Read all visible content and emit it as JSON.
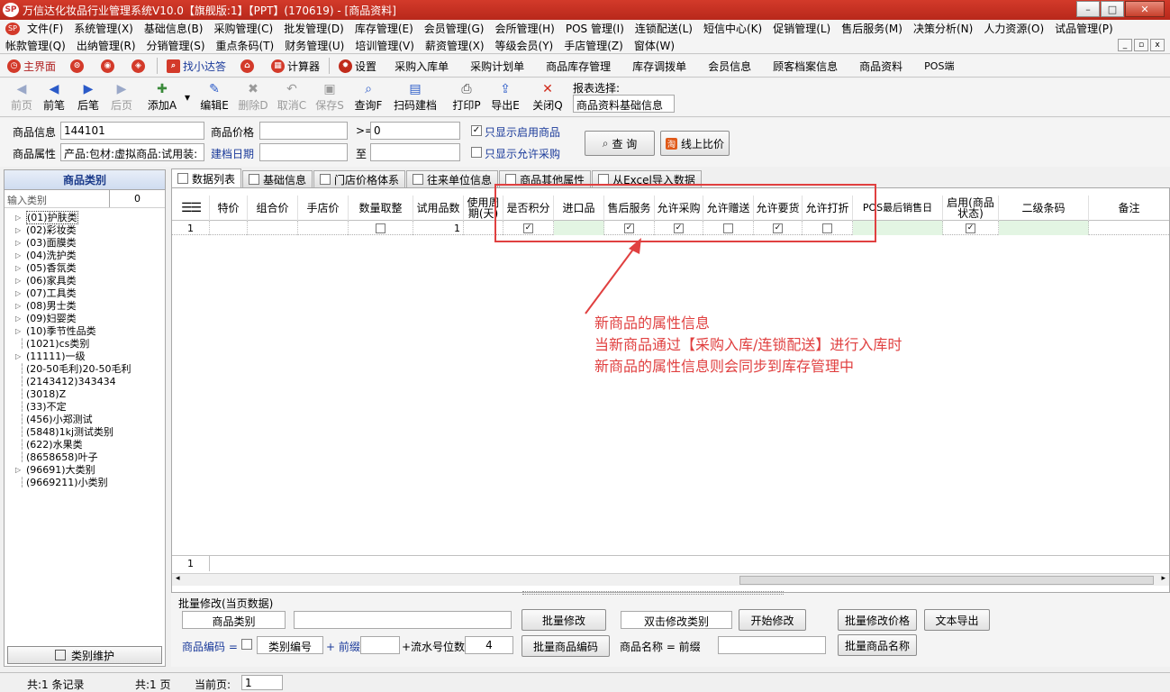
{
  "window": {
    "title": "万信达化妆品行业管理系统V10.0【旗舰版:1】【PPT】(170619) - [商品资料]",
    "logo": "SP",
    "buttons": [
      "–",
      "□",
      "✕"
    ]
  },
  "menu_row1": [
    "文件(F)",
    "系统管理(X)",
    "基础信息(B)",
    "采购管理(C)",
    "批发管理(D)",
    "库存管理(E)",
    "会员管理(G)",
    "会所管理(H)",
    "POS 管理(I)",
    "连锁配送(L)",
    "短信中心(K)",
    "促销管理(L)",
    "售后服务(M)",
    "决策分析(N)",
    "人力资源(O)",
    "试品管理(P)"
  ],
  "menu_row2": [
    "帐款管理(Q)",
    "出纳管理(R)",
    "分销管理(S)",
    "重点条码(T)",
    "财务管理(U)",
    "培训管理(V)",
    "薪资管理(X)",
    "等级会员(Y)",
    "手店管理(Z)",
    "窗体(W)"
  ],
  "mdi_buttons": [
    "_",
    "▫",
    "x"
  ],
  "quickbar": {
    "main": "主界面",
    "find": "找小达答",
    "calc": "计算器",
    "settings": "设置",
    "links": [
      "采购入库单",
      "采购计划单",
      "商品库存管理",
      "库存调拨单",
      "会员信息",
      "顾客档案信息",
      "商品资料",
      "POS端"
    ]
  },
  "actionbar": {
    "buttons": [
      {
        "label": "前页",
        "icon": "◀",
        "disabled": true
      },
      {
        "label": "前笔",
        "icon": "◀",
        "disabled": false
      },
      {
        "label": "后笔",
        "icon": "▶",
        "disabled": false
      },
      {
        "label": "后页",
        "icon": "▶",
        "disabled": true
      },
      {
        "label": "添加A",
        "icon": "✚",
        "disabled": false
      },
      {
        "label": "编辑E",
        "icon": "✎",
        "disabled": false
      },
      {
        "label": "删除D",
        "icon": "✖",
        "disabled": true
      },
      {
        "label": "取消C",
        "icon": "↶",
        "disabled": true
      },
      {
        "label": "保存S",
        "icon": "▣",
        "disabled": true
      },
      {
        "label": "查询F",
        "icon": "⌕",
        "disabled": false
      },
      {
        "label": "扫码建档",
        "icon": "▤",
        "disabled": false
      },
      {
        "label": "打印P",
        "icon": "⎙",
        "disabled": false
      },
      {
        "label": "导出E",
        "icon": "⇪",
        "disabled": false
      },
      {
        "label": "关闭Q",
        "icon": "✕",
        "disabled": false
      }
    ],
    "report_label": "报表选择:",
    "report_value": "商品资料基础信息"
  },
  "filter": {
    "product_info_label": "商品信息",
    "product_info_value": "144101",
    "price_label": "商品价格",
    "price_op": ">=",
    "price_value": "0",
    "only_enabled": "只显示启用商品",
    "attr_label": "商品属性",
    "attr_value": "产品:包材:虚拟商品:试用装:",
    "date_label": "建档日期",
    "date_to": "至",
    "only_purchase": "只显示允许采购",
    "query_btn": "查  询",
    "compare_btn": "线上比价"
  },
  "leftpanel": {
    "title": "商品类别",
    "search_placeholder": "输入类别",
    "search_count": "0",
    "categories": [
      {
        "label": "(01)护肤类",
        "expandable": true
      },
      {
        "label": "(02)彩妆类",
        "expandable": true
      },
      {
        "label": "(03)面膜类",
        "expandable": true
      },
      {
        "label": "(04)洗护类",
        "expandable": true
      },
      {
        "label": "(05)香氛类",
        "expandable": true
      },
      {
        "label": "(06)家具类",
        "expandable": true
      },
      {
        "label": "(07)工具类",
        "expandable": true
      },
      {
        "label": "(08)男士类",
        "expandable": true
      },
      {
        "label": "(09)妇婴类",
        "expandable": true
      },
      {
        "label": "(10)季节性品类",
        "expandable": true
      },
      {
        "label": "(1021)cs类别",
        "expandable": false
      },
      {
        "label": "(11111)一级",
        "expandable": true
      },
      {
        "label": "(20-50毛利)20-50毛利",
        "expandable": false
      },
      {
        "label": "(2143412)343434",
        "expandable": false
      },
      {
        "label": "(3018)Z",
        "expandable": false
      },
      {
        "label": "(33)不定",
        "expandable": false
      },
      {
        "label": "(456)小郑测试",
        "expandable": false
      },
      {
        "label": "(5848)1kj测试类别",
        "expandable": false
      },
      {
        "label": "(622)水果类",
        "expandable": false
      },
      {
        "label": "(8658658)叶子",
        "expandable": false
      },
      {
        "label": "(96691)大类别",
        "expandable": true
      },
      {
        "label": "(9669211)小类别",
        "expandable": false
      }
    ],
    "maintain_btn": "类别维护"
  },
  "tabs": [
    "数据列表",
    "基础信息",
    "门店价格体系",
    "往来单位信息",
    "商品其他属性",
    "从Excel导入数据"
  ],
  "grid": {
    "headers": [
      "特价",
      "组合价",
      "手店价",
      "数量取整",
      "试用品数",
      "使用周期(天)",
      "是否积分",
      "进口品",
      "售后服务",
      "允许采购",
      "允许赠送",
      "允许要货",
      "允许打折",
      "POS最后销售日",
      "启用(商品状态)",
      "二级条码",
      "备注"
    ],
    "row_number": "1",
    "trial_qty": "1",
    "footer_number": "1"
  },
  "annotation": [
    "新商品的属性信息",
    "当新商品通过【采购入库/连锁配送】进行入库时",
    "新商品的属性信息则会同步到库存管理中"
  ],
  "batch": {
    "title": "批量修改(当页数据)",
    "category_field": "商品类别",
    "batch_modify_btn": "批量修改",
    "dblclick_field": "双击修改类别",
    "start_btn": "开始修改",
    "batch_price_btn": "批量修改价格",
    "export_text_btn": "文本导出",
    "code_label": "商品编码 =",
    "category_code": "类别编号",
    "prefix_label": "+ 前缀",
    "serial_label": "+流水号位数",
    "serial_value": "4",
    "batch_code_btn": "批量商品编码",
    "name_label": "商品名称 = 前缀",
    "batch_name_btn": "批量商品名称"
  },
  "status": {
    "records": "共:1 条记录",
    "pages": "共:1 页",
    "current_label": "当前页:",
    "current_value": "1"
  }
}
